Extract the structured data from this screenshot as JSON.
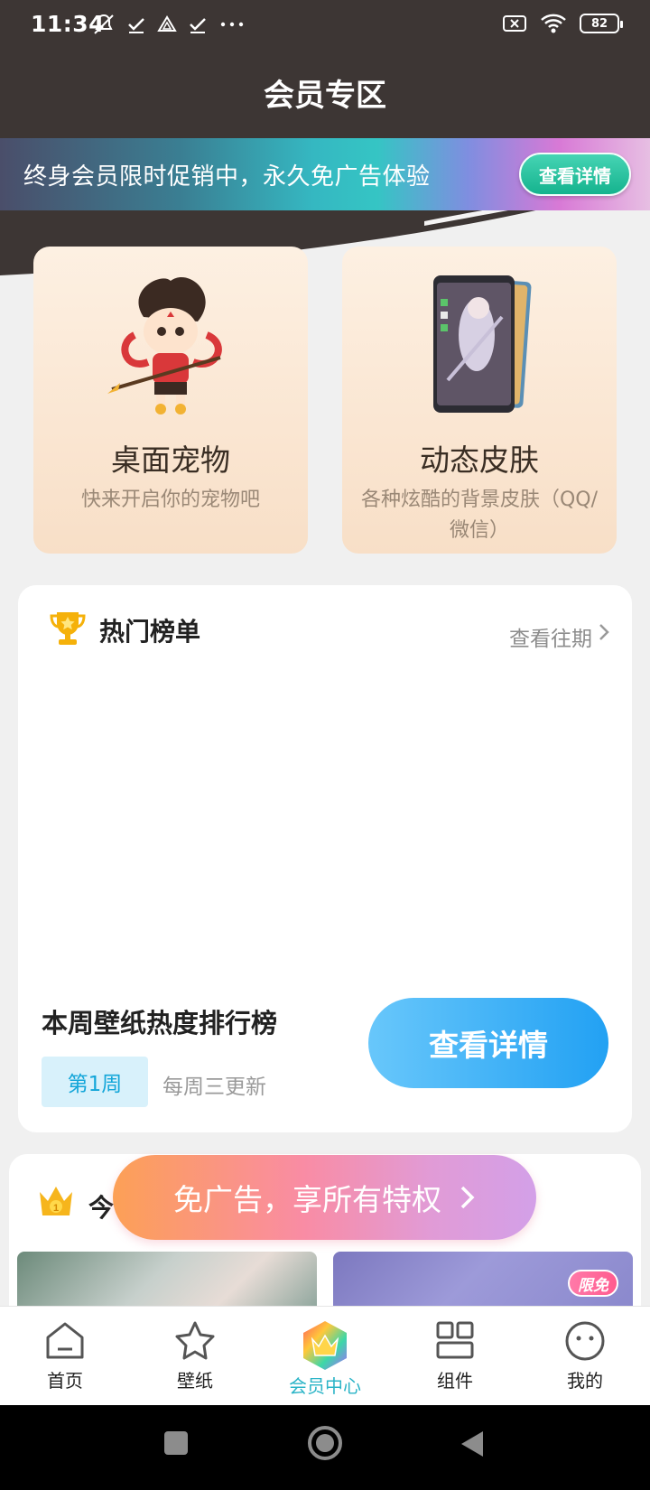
{
  "status_bar": {
    "time": "11:34",
    "battery": "82",
    "left_icons": [
      "mute-icon",
      "check-icon",
      "drive-icon",
      "check-icon",
      "more-icon"
    ],
    "right_icons": [
      "sim-off-icon",
      "wifi-icon",
      "battery-icon"
    ]
  },
  "header": {
    "title": "会员专区"
  },
  "promo": {
    "text": "终身会员限时促销中，永久免广告体验",
    "button": "查看详情"
  },
  "features": [
    {
      "title": "桌面宠物",
      "subtitle": "快来开启你的宠物吧",
      "icon": "pet-character-image"
    },
    {
      "title": "动态皮肤",
      "subtitle": "各种炫酷的背景皮肤（QQ/微信）",
      "icon": "phone-skin-image"
    }
  ],
  "ranking": {
    "title": "热门榜单",
    "history": "查看往期",
    "weekly_title": "本周壁纸热度排行榜",
    "week_badge": "第1周",
    "update_note": "每周三更新",
    "detail_button": "查看详情"
  },
  "today": {
    "title": "今",
    "free_tag": "限免"
  },
  "vip_cta": {
    "label": "免广告，享所有特权"
  },
  "tabs": [
    {
      "label": "首页",
      "icon": "home-icon"
    },
    {
      "label": "壁纸",
      "icon": "star-icon"
    },
    {
      "label": "会员中心",
      "icon": "vip-crown-icon"
    },
    {
      "label": "组件",
      "icon": "widgets-icon"
    },
    {
      "label": "我的",
      "icon": "smile-icon"
    }
  ],
  "colors": {
    "header_bg": "#3d3634",
    "accent_teal": "#2bb4c7",
    "rank_button": "#22a1f3",
    "promo_button": "#15b38e"
  }
}
